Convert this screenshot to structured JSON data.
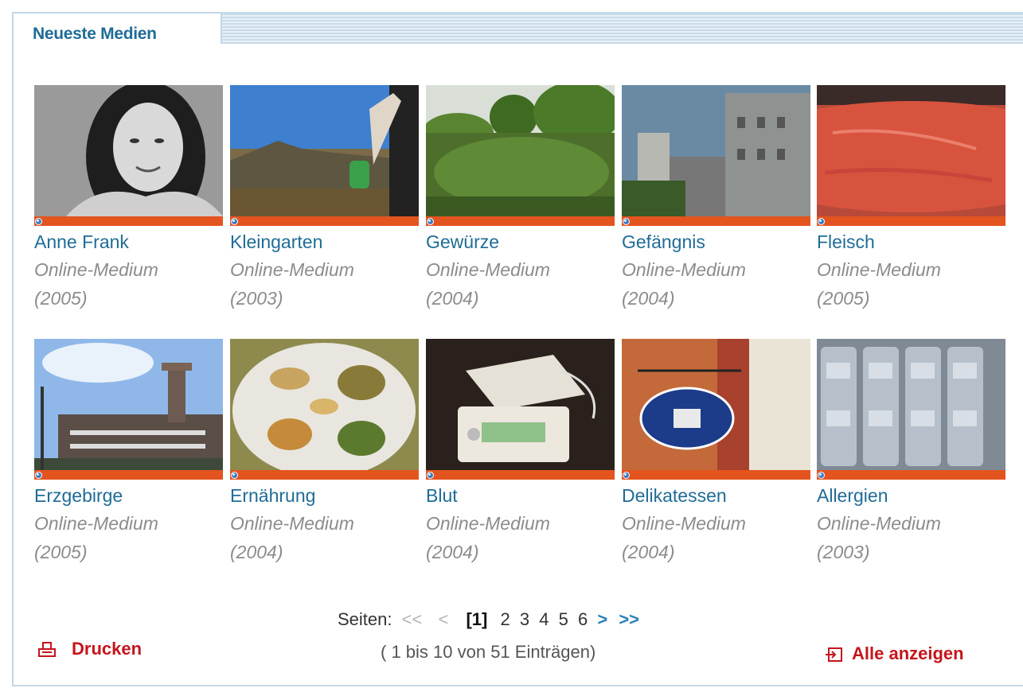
{
  "panel": {
    "title": "Neueste Medien"
  },
  "media": [
    {
      "title": "Anne Frank",
      "type": "Online-Medium",
      "year": "(2005)",
      "thumb": "portrait"
    },
    {
      "title": "Kleingarten",
      "type": "Online-Medium",
      "year": "(2003)",
      "thumb": "garden"
    },
    {
      "title": "Gewürze",
      "type": "Online-Medium",
      "year": "(2004)",
      "thumb": "herbs"
    },
    {
      "title": "Gefängnis",
      "type": "Online-Medium",
      "year": "(2004)",
      "thumb": "building"
    },
    {
      "title": "Fleisch",
      "type": "Online-Medium",
      "year": "(2005)",
      "thumb": "meat"
    },
    {
      "title": "Erzgebirge",
      "type": "Online-Medium",
      "year": "(2005)",
      "thumb": "tower"
    },
    {
      "title": "Ernährung",
      "type": "Online-Medium",
      "year": "(2004)",
      "thumb": "plate"
    },
    {
      "title": "Blut",
      "type": "Online-Medium",
      "year": "(2004)",
      "thumb": "device"
    },
    {
      "title": "Delikatessen",
      "type": "Online-Medium",
      "year": "(2004)",
      "thumb": "sign"
    },
    {
      "title": "Allergien",
      "type": "Online-Medium",
      "year": "(2003)",
      "thumb": "shelves"
    }
  ],
  "pagination": {
    "label": "Seiten:",
    "first": "<<",
    "prev": "<",
    "current": "[1]",
    "pages": [
      "2",
      "3",
      "4",
      "5",
      "6"
    ],
    "next": ">",
    "last": ">>",
    "summary": "( 1 bis 10 von 51 Einträgen)"
  },
  "actions": {
    "print_label": "Drucken",
    "show_all_label": "Alle anzeigen"
  },
  "colors": {
    "accent_blue": "#1f6c96",
    "orange_bar": "#e3541f",
    "action_red": "#c4151c"
  }
}
